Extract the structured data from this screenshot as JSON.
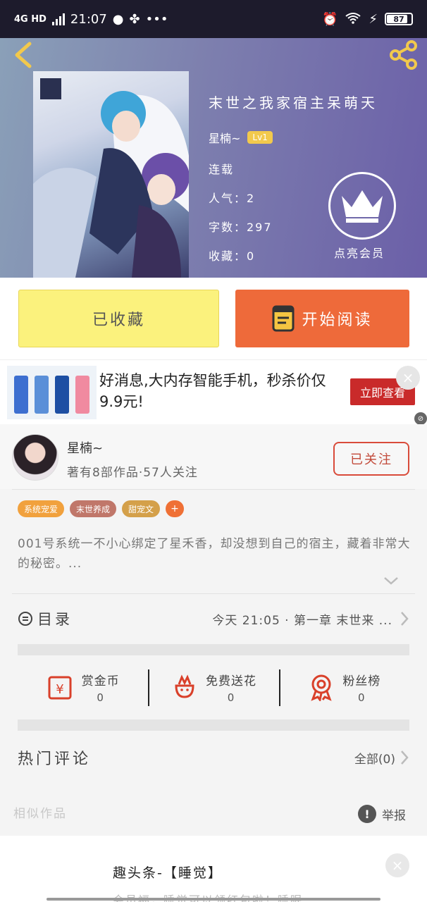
{
  "status_bar": {
    "network": "4G HD",
    "time": "21:07",
    "dots": "•••",
    "battery": "87"
  },
  "book": {
    "title": "末世之我家宿主呆萌天",
    "author": "星楠~",
    "level_badge": "Lv1",
    "status": "连载",
    "popularity": "人气：2",
    "word_count": "字数：297",
    "collections": "收藏：0",
    "vip_label": "点亮会员"
  },
  "actions": {
    "collected_label": "已收藏",
    "read_label": "开始阅读"
  },
  "ad": {
    "text": "好消息,大内存智能手机，秒杀价仅9.9元!",
    "cta": "立即查看",
    "close": "×",
    "mark": "⊘"
  },
  "author_card": {
    "name": "星楠~",
    "stats": "著有8部作品·57人关注",
    "follow_label": "已关注"
  },
  "tags": [
    {
      "label": "系统宠爱",
      "color": "#f1a13d"
    },
    {
      "label": "末世养成",
      "color": "#c0776a"
    },
    {
      "label": "甜宠文",
      "color": "#d4a04a"
    },
    {
      "label": "+",
      "color": "#ef7035"
    }
  ],
  "synopsis": "001号系统一不小心绑定了星禾香，却没想到自己的宿主，藏着非常大的秘密。...",
  "catalog": {
    "label": "目录",
    "latest": "今天 21:05 · 第一章 末世来 ..."
  },
  "rewards": [
    {
      "label": "赏金币",
      "count": "0",
      "icon": "coin-icon"
    },
    {
      "label": "免费送花",
      "count": "0",
      "icon": "flower-icon"
    },
    {
      "label": "粉丝榜",
      "count": "0",
      "icon": "medal-icon"
    }
  ],
  "comments": {
    "label": "热门评论",
    "all": "全部(0)"
  },
  "similar": {
    "label": "相似作品"
  },
  "report": {
    "label": "举报",
    "icon_text": "!"
  },
  "bottom_ad": {
    "title": "趣头条-【睡觉】",
    "subtitle": "会员福，睡觉可以领红包啦！睡眠",
    "close": "×"
  },
  "colors": {
    "accent": "#ee6a3a",
    "collected": "#fbf27d",
    "follow_border": "#d94b3a"
  }
}
